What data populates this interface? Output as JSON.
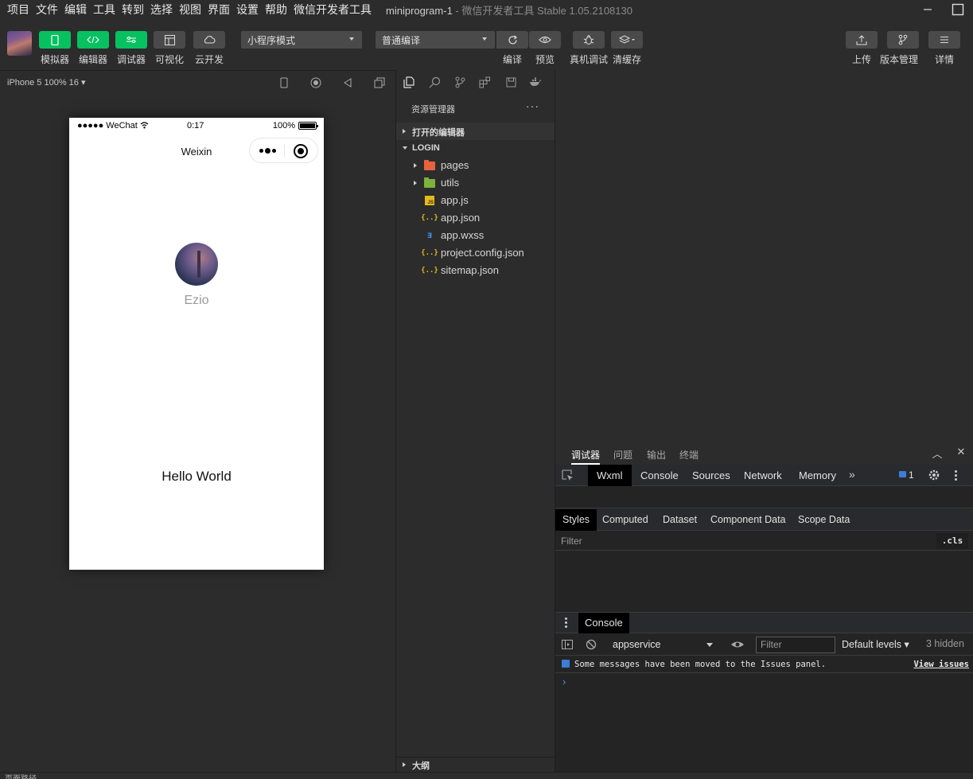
{
  "menubar": {
    "items": [
      "项目",
      "文件",
      "编辑",
      "工具",
      "转到",
      "选择",
      "视图",
      "界面",
      "设置",
      "帮助",
      "微信开发者工具"
    ],
    "title_project": "miniprogram-1",
    "title_rest": " - 微信开发者工具 Stable 1.05.2108130"
  },
  "toolbar": {
    "simulator": "模拟器",
    "editor": "编辑器",
    "debugger": "调试器",
    "visualize": "可视化",
    "cloud": "云开发",
    "mode_select": "小程序模式",
    "compile_select": "普通编译",
    "compile": "编译",
    "preview": "预览",
    "remote_debug": "真机调试",
    "clear_cache": "清缓存",
    "upload": "上传",
    "version": "版本管理",
    "details": "详情",
    "accent_green": "#07c160"
  },
  "simulator": {
    "device": "iPhone 5 100% 16 ▾",
    "status_signal": "●●●●● WeChat",
    "status_time": "0:17",
    "status_battery": "100%",
    "nav_title": "Weixin",
    "nickname": "Ezio",
    "hello_text": "Hello World"
  },
  "explorer": {
    "title": "资源管理器",
    "more": "···",
    "open_editors": "打开的编辑器",
    "project": "LOGIN",
    "files": [
      {
        "name": "pages",
        "icon": "folder-icon"
      },
      {
        "name": "utils",
        "icon": "folder-icon"
      },
      {
        "name": "app.js",
        "icon": "js-file-icon"
      },
      {
        "name": "app.json",
        "icon": "json-file-icon"
      },
      {
        "name": "app.wxss",
        "icon": "wxss-file-icon"
      },
      {
        "name": "project.config.json",
        "icon": "json-file-icon"
      },
      {
        "name": "sitemap.json",
        "icon": "json-file-icon"
      }
    ],
    "outline": "大纲"
  },
  "debugger": {
    "tabs": [
      "调试器",
      "问题",
      "输出",
      "终端"
    ],
    "devtools_tabs": [
      "Wxml",
      "Console",
      "Sources",
      "Network",
      "Memory"
    ],
    "issues_count": "1",
    "styles_tabs": [
      "Styles",
      "Computed",
      "Dataset",
      "Component Data",
      "Scope Data"
    ],
    "filter_placeholder": "Filter",
    "cls_label": ".cls",
    "console_tab": "Console",
    "context": "appservice",
    "console_filter": "Filter",
    "levels": "Default levels ▾",
    "hidden": "3 hidden",
    "message": "Some messages have been moved to the Issues panel.",
    "view_issues": "View issues",
    "prompt": "›"
  },
  "footer": {
    "left": "页面路径"
  }
}
